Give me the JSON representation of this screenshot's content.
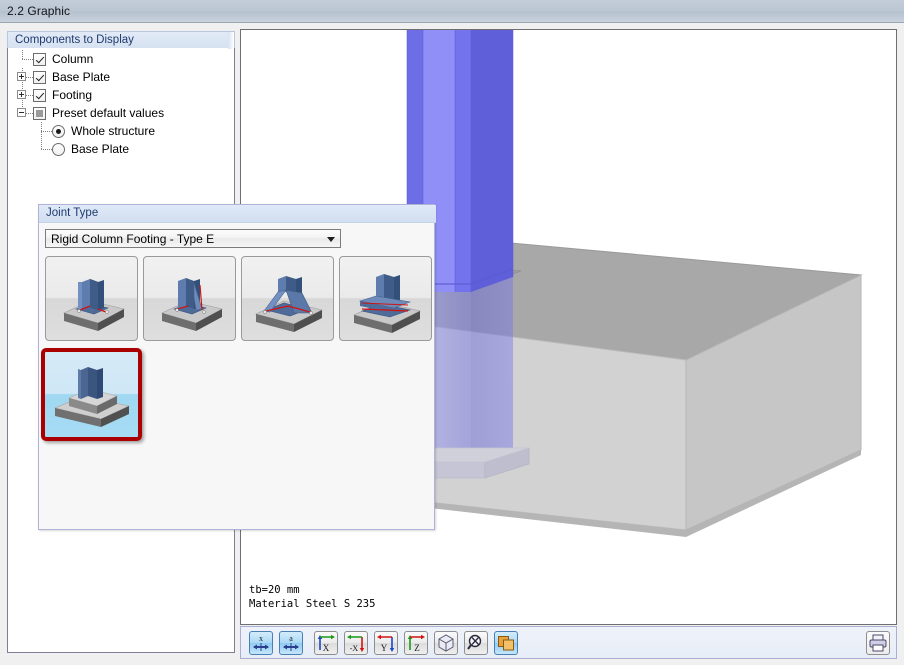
{
  "window": {
    "title": "2.2 Graphic"
  },
  "components_panel": {
    "title": "Components to Display",
    "tree": [
      {
        "label": "Column",
        "control": "checkbox",
        "state": "checked",
        "expander": "none",
        "level": 0
      },
      {
        "label": "Base Plate",
        "control": "checkbox",
        "state": "checked",
        "expander": "plus",
        "level": 0
      },
      {
        "label": "Footing",
        "control": "checkbox",
        "state": "checked",
        "expander": "plus",
        "level": 0
      },
      {
        "label": "Preset default values",
        "control": "checkbox",
        "state": "indeterminate",
        "expander": "minus",
        "level": 0
      },
      {
        "label": "Whole structure",
        "control": "radio",
        "state": "selected",
        "expander": "none",
        "level": 1
      },
      {
        "label": "Base Plate",
        "control": "radio",
        "state": "unselected",
        "expander": "none",
        "level": 1
      }
    ]
  },
  "joint_type_panel": {
    "title": "Joint Type",
    "dropdown": {
      "selected": "Rigid Column Footing - Type E",
      "options": [
        "Rigid Column Footing - Type E"
      ]
    },
    "thumbnails": [
      {
        "name": "base-plate-anchored",
        "selected": false
      },
      {
        "name": "base-plate-stiffened",
        "selected": false
      },
      {
        "name": "base-plate-haunched",
        "selected": false
      },
      {
        "name": "base-plate-beam-on-cap",
        "selected": false
      },
      {
        "name": "column-in-pocket-footing",
        "selected": true
      }
    ]
  },
  "graphic": {
    "annotation_line1": "tb=20 mm",
    "annotation_line2": "Material Steel S 235",
    "colors": {
      "column": "#6a6ae8",
      "concrete": "#c9c9c9",
      "background": "#ffffff"
    }
  },
  "toolbar": {
    "buttons": [
      {
        "name": "scale-x-button",
        "glyph": "x",
        "active": true
      },
      {
        "name": "scale-a-button",
        "glyph": "a",
        "active": true
      },
      {
        "name": "view-x-button",
        "glyph": "X",
        "active": false
      },
      {
        "name": "view-minus-x-button",
        "glyph": "-X",
        "active": false
      },
      {
        "name": "view-y-button",
        "glyph": "Y",
        "active": false
      },
      {
        "name": "view-z-button",
        "glyph": "Z",
        "active": false
      },
      {
        "name": "isometric-view-button",
        "glyph": "cube",
        "active": false
      },
      {
        "name": "zoom-previous-button",
        "glyph": "zoom",
        "active": false
      },
      {
        "name": "render-mode-button",
        "glyph": "layers",
        "active": true
      }
    ],
    "print_button": {
      "name": "print-button"
    }
  }
}
